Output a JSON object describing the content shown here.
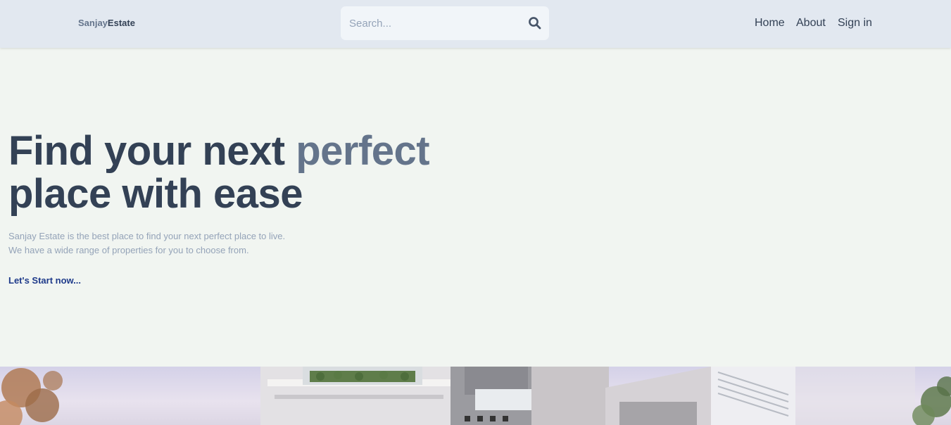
{
  "header": {
    "logo": {
      "part1": "Sanjay",
      "part2": "Estate"
    },
    "search": {
      "placeholder": "Search..."
    },
    "nav": {
      "home": "Home",
      "about": "About",
      "signin": "Sign in"
    }
  },
  "hero": {
    "title_part1": "Find your next ",
    "title_accent": "perfect",
    "title_line2": "place with ease",
    "description_line1": "Sanjay Estate is the best place to find your next perfect place to live.",
    "description_line2": "We have a wide range of properties for you to choose from.",
    "cta": "Let's Start now..."
  },
  "colors": {
    "header_bg": "#e2e8f0",
    "page_bg": "#f1f5f1",
    "text_dark": "#334155",
    "text_accent": "#64748b",
    "text_muted": "#94a3b8",
    "link": "#1e3a8a"
  },
  "icons": {
    "search": "search-icon"
  },
  "banner": {
    "content": "house-photo"
  }
}
